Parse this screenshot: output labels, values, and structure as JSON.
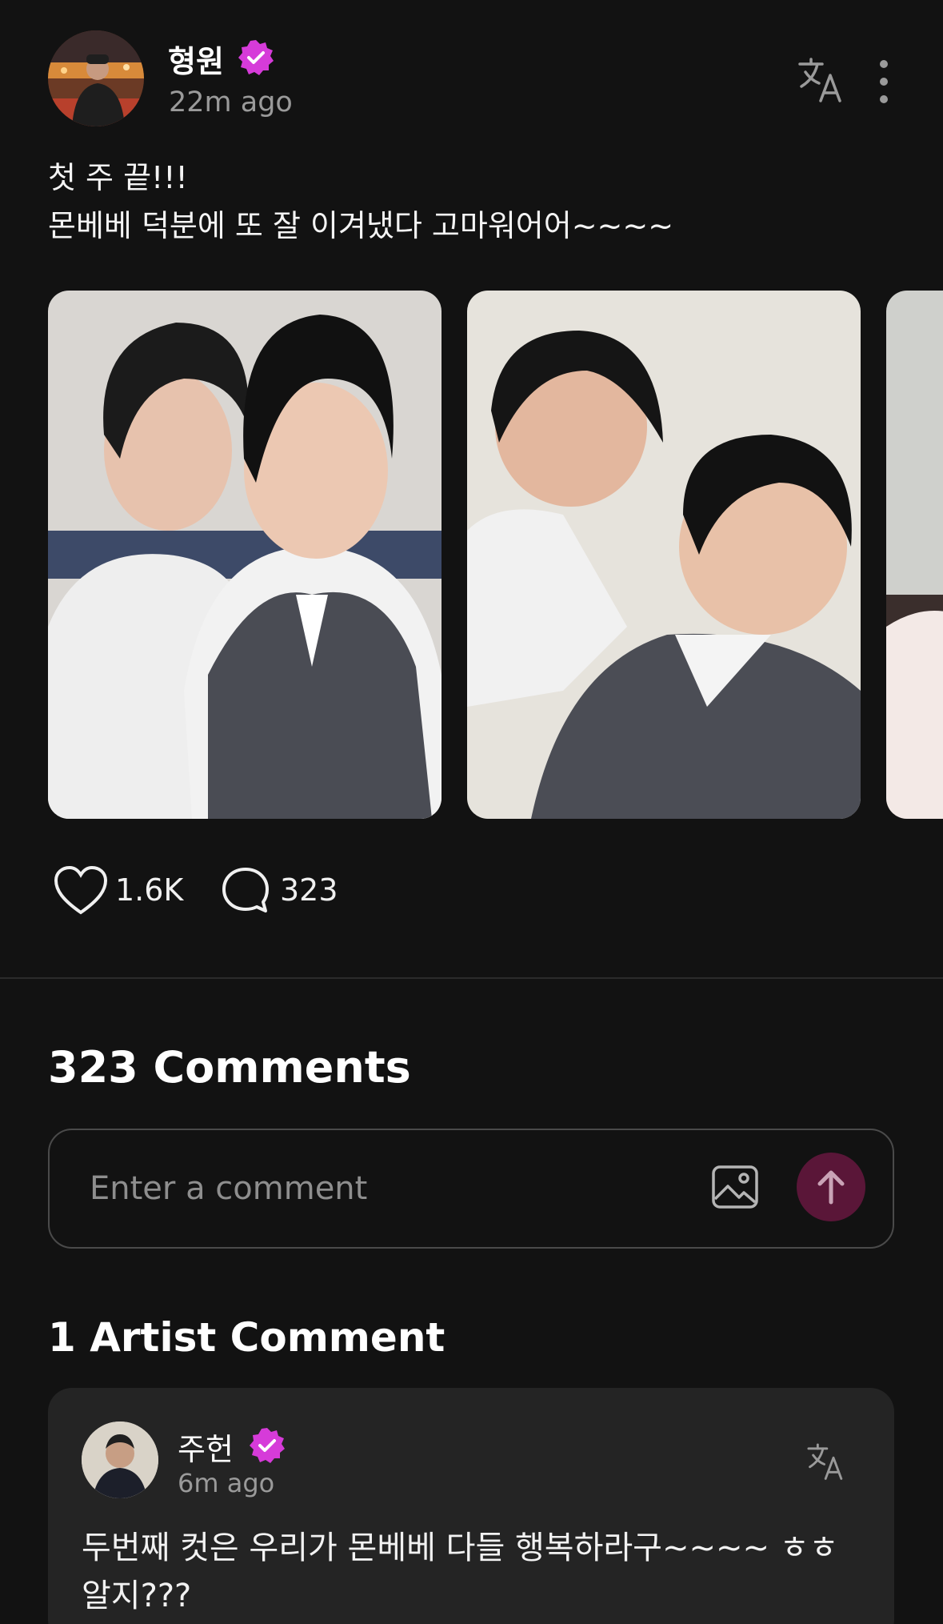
{
  "post": {
    "author": "형원",
    "time": "22m ago",
    "text_lines": [
      "첫 주 끝!!!",
      "몬베베 덕분에 또 잘 이겨냈다  고마워어어~~~~"
    ],
    "likes": "1.6K",
    "comments": "323",
    "photos": [
      "photo-1",
      "photo-2",
      "photo-3"
    ]
  },
  "comments_section": {
    "title": "323 Comments",
    "input_placeholder": "Enter a comment"
  },
  "artist_comments": {
    "title": "1 Artist Comment",
    "items": [
      {
        "author": "주헌",
        "time": "6m ago",
        "text": "두번째 컷은 우리가 몬베베 다들 행복하라구~~~~ ㅎㅎ 알지???"
      }
    ]
  },
  "icons": [
    "verified-icon",
    "translate-icon",
    "more-vertical-icon",
    "heart-icon",
    "comment-icon",
    "image-icon",
    "arrow-up-icon"
  ],
  "colors": {
    "background": "#121212",
    "accent_verified": "#d63bd9",
    "send_button": "#5a1638",
    "card": "#242424"
  }
}
